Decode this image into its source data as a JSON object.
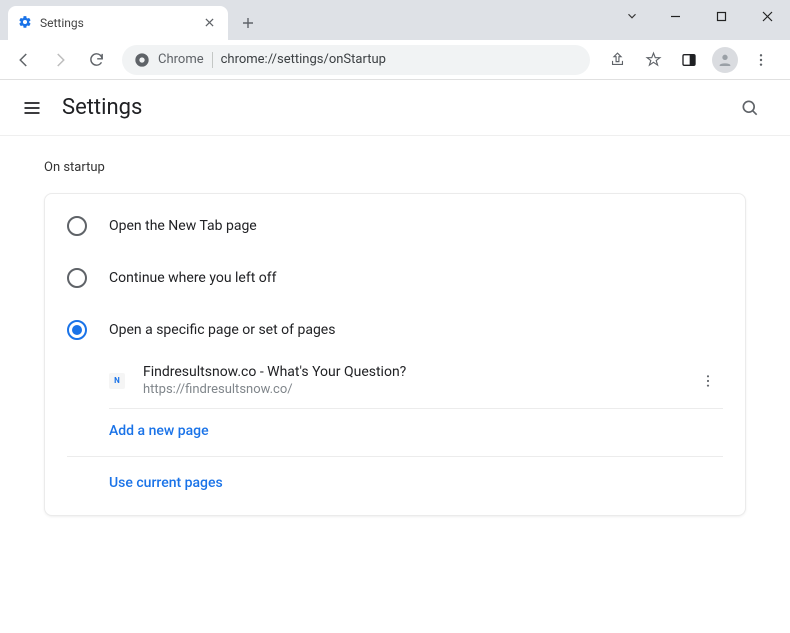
{
  "titlebar": {
    "tab_title": "Settings",
    "tab_favicon": "gear-icon"
  },
  "toolbar": {
    "chrome_label": "Chrome",
    "url": "chrome://settings/onStartup"
  },
  "header": {
    "title": "Settings"
  },
  "main": {
    "section_title": "On startup",
    "options": [
      {
        "label": "Open the New Tab page",
        "selected": false
      },
      {
        "label": "Continue where you left off",
        "selected": false
      },
      {
        "label": "Open a specific page or set of pages",
        "selected": true
      }
    ],
    "pages": [
      {
        "title": "Findresultsnow.co - What's Your Question?",
        "url": "https://findresultsnow.co/",
        "favicon_text": "N"
      }
    ],
    "add_page_label": "Add a new page",
    "use_current_label": "Use current pages"
  }
}
